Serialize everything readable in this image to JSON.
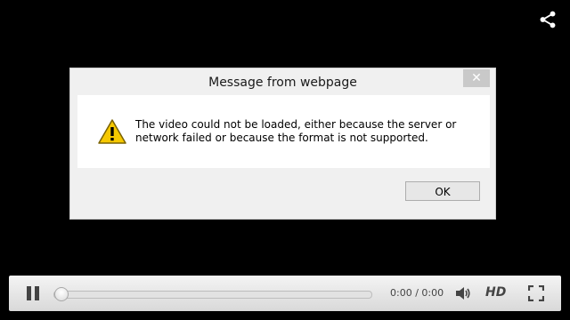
{
  "dialog": {
    "title": "Message from webpage",
    "close_glyph": "✕",
    "message": "The video could not be loaded, either because the server or network failed or because the format is not supported.",
    "ok_label": "OK",
    "icon": "warning-icon"
  },
  "player": {
    "time": "0:00 / 0:00",
    "hd_label": "HD",
    "progress_percent": 0,
    "icons": [
      "share-icon",
      "pause-icon",
      "volume-icon",
      "fullscreen-icon"
    ]
  },
  "colors": {
    "background": "#000000",
    "warning_yellow": "#f6c800"
  }
}
